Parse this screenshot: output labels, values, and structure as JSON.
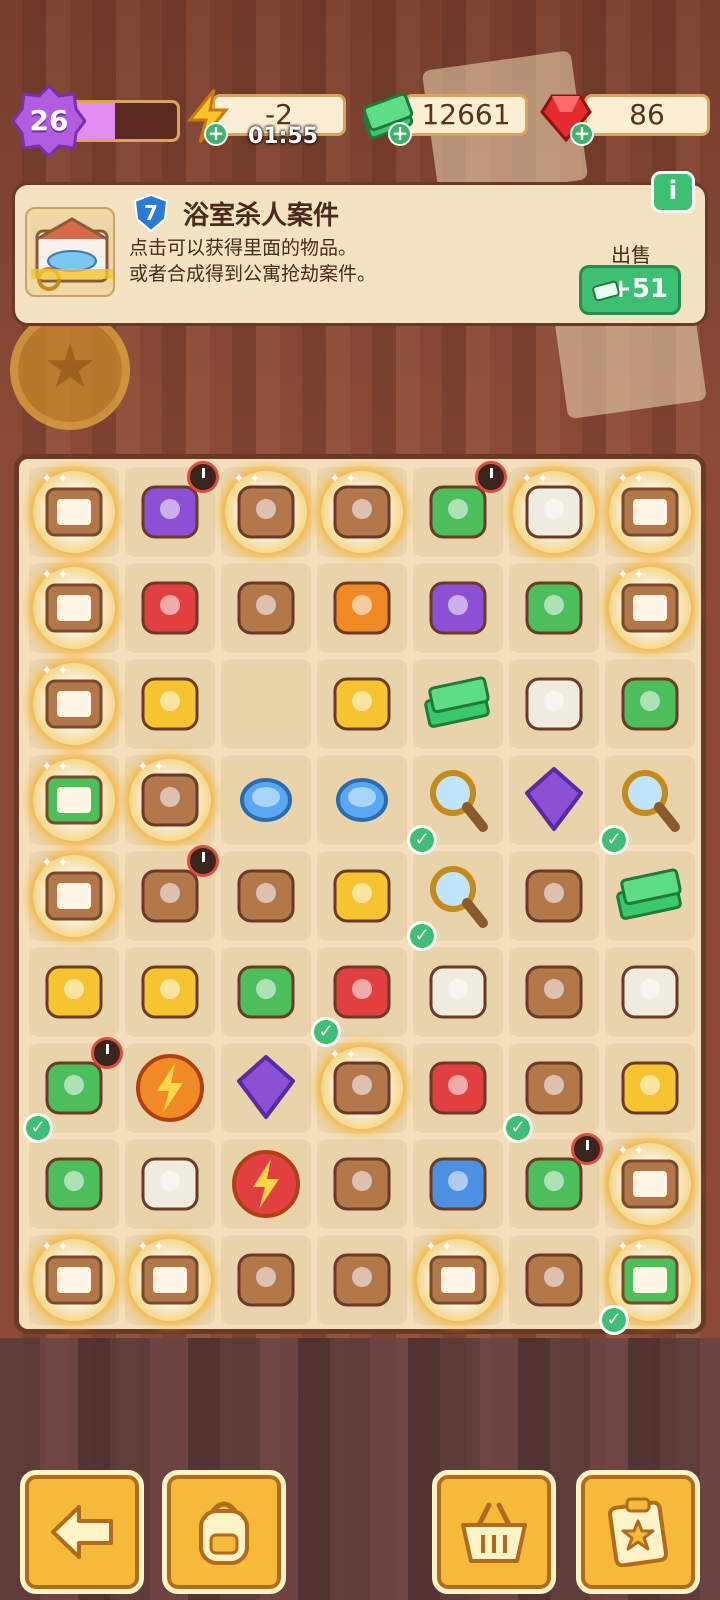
{
  "hud": {
    "level": "26",
    "level_progress": 0.4,
    "energy_value": "-2",
    "energy_timer": "01:55",
    "cash_value": "12661",
    "gems_value": "86"
  },
  "info": {
    "level_badge": "7",
    "title": "浴室杀人案件",
    "description": "点击可以获得里面的物品。\n或者合成得到公寓抢劫案件。",
    "sell_label": "出售",
    "sell_amount": "+51",
    "info_button": "i"
  },
  "colors": {
    "accent_green": "#3dbf74",
    "board_bg": "#f3dfbb",
    "level_purple": "#b25de0",
    "button_orange": "#f7b93a"
  },
  "board": {
    "rows": [
      [
        {
          "icon": "bathroom-case-icon",
          "glow": true
        },
        {
          "icon": "purple-car-icon",
          "clock": true
        },
        {
          "icon": "broken-chest-icon",
          "glow": true
        },
        {
          "icon": "first-aid-kit-icon",
          "glow": true
        },
        {
          "icon": "green-arcade-box-icon",
          "clock": true
        },
        {
          "icon": "white-chest-icon",
          "glow": true
        },
        {
          "icon": "bathtub-case-icon",
          "glow": true
        }
      ],
      [
        {
          "icon": "bathroom-case-icon",
          "glow": true
        },
        {
          "icon": "red-toolbox-icon"
        },
        {
          "icon": "photo-icon"
        },
        {
          "icon": "orange-envelope-icon"
        },
        {
          "icon": "purple-scooter-icon"
        },
        {
          "icon": "green-broom-icon"
        },
        {
          "icon": "bathtub-case-icon",
          "glow": true
        }
      ],
      [
        {
          "icon": "tools-case-icon",
          "glow": true
        },
        {
          "icon": "yellow-bucket-icon"
        },
        {
          "icon": "empty"
        },
        {
          "icon": "caution-barrier-icon"
        },
        {
          "icon": "cash-stack-icon"
        },
        {
          "icon": "white-bench-icon"
        },
        {
          "icon": "potted-plant-icon"
        }
      ],
      [
        {
          "icon": "plant-case-icon",
          "glow": true
        },
        {
          "icon": "lucky-cat-icon",
          "glow": true
        },
        {
          "icon": "blue-plate-icon"
        },
        {
          "icon": "blue-plate-icon"
        },
        {
          "icon": "magnifier-icon",
          "check": true
        },
        {
          "icon": "purple-gem-icon"
        },
        {
          "icon": "magnifier-icon",
          "check": true
        }
      ],
      [
        {
          "icon": "portrait-case-icon",
          "glow": true
        },
        {
          "icon": "vase-icon",
          "clock": true
        },
        {
          "icon": "footprint-evidence-icon"
        },
        {
          "icon": "caution-tape-icon"
        },
        {
          "icon": "magnifier-icon",
          "check": true
        },
        {
          "icon": "star-trophy-icon"
        },
        {
          "icon": "cash-bundle-icon"
        }
      ],
      [
        {
          "icon": "golden-statue-icon"
        },
        {
          "icon": "bee-icon"
        },
        {
          "icon": "berry-bush-icon"
        },
        {
          "icon": "red-gloves-icon",
          "check": true
        },
        {
          "icon": "sunglasses-icon"
        },
        {
          "icon": "cookie-icon"
        },
        {
          "icon": "glass-table-icon"
        }
      ],
      [
        {
          "icon": "flower-planter-icon",
          "clock": true,
          "check": true
        },
        {
          "icon": "orange-energy-icon"
        },
        {
          "icon": "purple-blob-icon"
        },
        {
          "icon": "lamp-figure-icon",
          "glow": true
        },
        {
          "icon": "red-box-icon"
        },
        {
          "icon": "soap-bottle-icon",
          "check": true
        },
        {
          "icon": "honey-jar-icon"
        }
      ],
      [
        {
          "icon": "green-mop-icon"
        },
        {
          "icon": "tissue-box-icon"
        },
        {
          "icon": "red-energy-icon"
        },
        {
          "icon": "plunger-icon"
        },
        {
          "icon": "id-card-icon"
        },
        {
          "icon": "green-arcade-box-icon",
          "clock": true
        },
        {
          "icon": "map-case-icon",
          "glow": true
        }
      ],
      [
        {
          "icon": "window-case-icon",
          "glow": true
        },
        {
          "icon": "box-case-icon",
          "glow": true
        },
        {
          "icon": "rolled-bag-icon"
        },
        {
          "icon": "wanted-poster-icon"
        },
        {
          "icon": "character-case-icon",
          "glow": true
        },
        {
          "icon": "chess-piece-icon"
        },
        {
          "icon": "tree-case-icon",
          "glow": true,
          "check": true
        }
      ]
    ]
  },
  "toolbar": {
    "back": "back-arrow-icon",
    "backpack": "backpack-icon",
    "basket": "basket-icon",
    "tasks": "clipboard-star-icon"
  }
}
